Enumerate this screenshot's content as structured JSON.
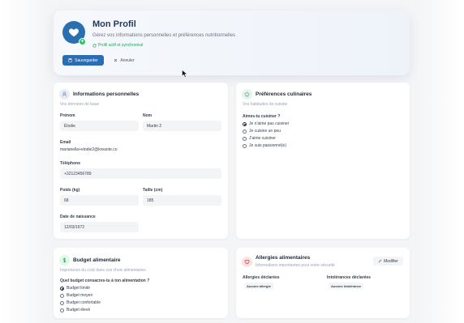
{
  "header": {
    "title": "Mon Profil",
    "subtitle": "Gérez vos informations personnelles et préférences nutritionnelles",
    "sync_status": "Profil actif et synchronisé",
    "save_label": "Sauvegarder",
    "cancel_label": "Annuler"
  },
  "personal": {
    "title": "Informations personnelles",
    "desc": "Vos données de base",
    "first_name_label": "Prénom",
    "first_name_value": "Élodie",
    "last_name_label": "Nom",
    "last_name_value": "Martin 2",
    "email_label": "Email",
    "email_value": "marianella+elodie2@kreante.co",
    "phone_label": "Téléphone",
    "phone_value": "+32123456789",
    "weight_label": "Poids (kg)",
    "weight_value": "68",
    "height_label": "Taille (cm)",
    "height_value": "185",
    "birth_label": "Date de naissance",
    "birth_value": "12/03/1972"
  },
  "culinary": {
    "title": "Préférences culinaires",
    "desc": "Vos habitudes de cuisine",
    "question": "Aimes-tu cuisiner ?",
    "options": [
      "Je n'aime pas cuisiner",
      "Je cuisine un peu",
      "J'aime cuisiner",
      "Je suis passionné(e)"
    ],
    "selected": 0
  },
  "budget": {
    "title": "Budget alimentaire",
    "desc": "Importance du coût dans vos choix alimentaires",
    "question": "Quel budget consacres-tu à ton alimentation ?",
    "options": [
      "Budget limité",
      "Budget moyen",
      "Budget confortable",
      "Budget élevé"
    ],
    "selected": 0
  },
  "allergies": {
    "title": "Allergies alimentaires",
    "desc": "Informations importantes pour votre sécurité",
    "modify_label": "Modifier",
    "allergies_label": "Allergies déclarées",
    "allergies_value": "Aucune allergie",
    "intolerances_label": "Intolérances déclarées",
    "intolerances_value": "Aucune intolérance"
  },
  "colors": {
    "primary": "#2a6db3",
    "success": "#22c55e",
    "budget_icon_bg": "#dcfce7",
    "allergy_icon_bg": "#fee2e2",
    "culinary_icon_bg": "#e6f4ef",
    "personal_icon_bg": "#e8eef7"
  },
  "icons": [
    "heart-icon",
    "check-badge-icon",
    "refresh-icon",
    "save-icon",
    "close-icon",
    "user-icon",
    "chef-hat-icon",
    "dollar-icon",
    "heart-outline-icon",
    "pencil-icon",
    "cursor-icon"
  ]
}
